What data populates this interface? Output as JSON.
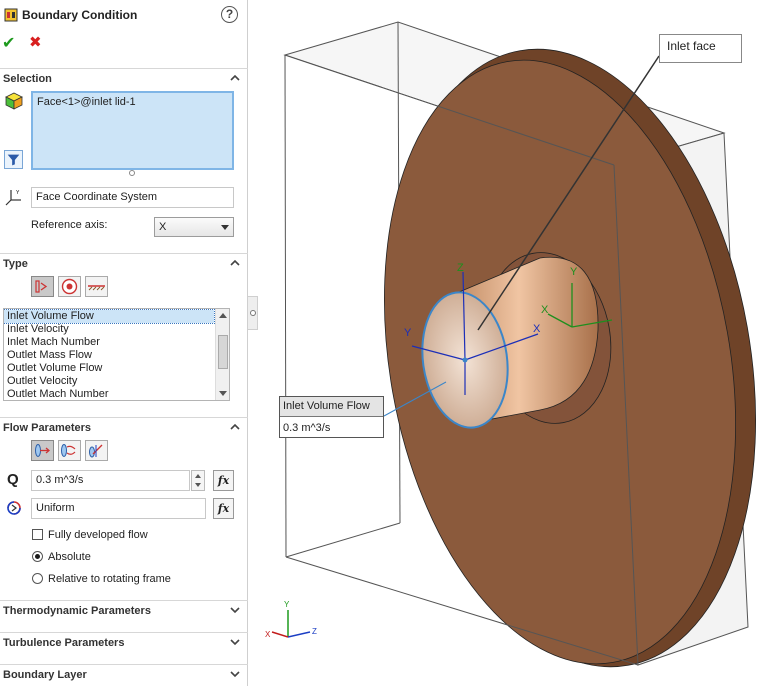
{
  "panel": {
    "title": "Boundary Condition",
    "help": "?",
    "ok": "✔",
    "cancel": "✖",
    "selection": {
      "header": "Selection",
      "selected_face": "Face<1>@inlet lid-1",
      "coordinate_system": "Face Coordinate System",
      "reference_axis_label": "Reference axis:",
      "reference_axis_value": "X"
    },
    "type": {
      "header": "Type",
      "items": [
        "Inlet Volume Flow",
        "Inlet Velocity",
        "Inlet Mach Number",
        "Outlet Mass Flow",
        "Outlet Volume Flow",
        "Outlet Velocity",
        "Outlet Mach Number"
      ],
      "selected_index": 0
    },
    "flow_parameters": {
      "header": "Flow Parameters",
      "q_symbol": "Q",
      "q_value": "0.3 m^3/s",
      "fx": "fx",
      "profile_value": "Uniform",
      "fully_developed_label": "Fully developed flow",
      "fully_developed_checked": false,
      "absolute_label": "Absolute",
      "relative_label": "Relative to rotating frame",
      "selected_frame": "Absolute"
    },
    "collapsed_sections": [
      "Thermodynamic Parameters",
      "Turbulence Parameters",
      "Boundary Layer"
    ]
  },
  "viewport": {
    "callout_title": "Inlet face",
    "flow_callout_title": "Inlet Volume Flow",
    "flow_callout_value": "0.3 m^3/s",
    "axis_labels": {
      "x": "X",
      "y": "Y",
      "z": "Z"
    },
    "colors": {
      "disk": "#8b5a3c",
      "pipe": "#d4a17a",
      "axis_x": "#1c2fb8",
      "axis_y": "#1e8f1e",
      "axis_z": "#1e8f1e",
      "triad_x": "#c21b1b",
      "triad_y": "#1e9a1e",
      "triad_z": "#1b3ec4"
    }
  }
}
